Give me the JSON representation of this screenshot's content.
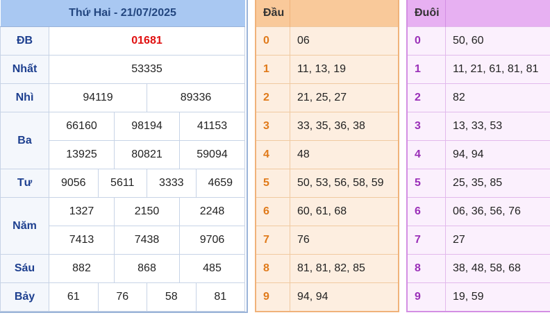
{
  "results": {
    "title": "Thứ Hai - 21/07/2025",
    "prizes": [
      {
        "label": "ĐB",
        "values": [
          "01681"
        ]
      },
      {
        "label": "Nhất",
        "values": [
          "53335"
        ]
      },
      {
        "label": "Nhì",
        "values": [
          "94119",
          "89336"
        ]
      },
      {
        "label": "Ba",
        "values": [
          "66160",
          "98194",
          "41153",
          "13925",
          "80821",
          "59094"
        ]
      },
      {
        "label": "Tư",
        "values": [
          "9056",
          "5611",
          "3333",
          "4659"
        ]
      },
      {
        "label": "Năm",
        "values": [
          "1327",
          "2150",
          "2248",
          "7413",
          "7438",
          "9706"
        ]
      },
      {
        "label": "Sáu",
        "values": [
          "882",
          "868",
          "485"
        ]
      },
      {
        "label": "Bảy",
        "values": [
          "61",
          "76",
          "58",
          "81"
        ]
      }
    ]
  },
  "dau": {
    "header": "Đầu",
    "rows": [
      {
        "k": "0",
        "v": "06"
      },
      {
        "k": "1",
        "v": "11, 13, 19"
      },
      {
        "k": "2",
        "v": "21, 25, 27"
      },
      {
        "k": "3",
        "v": "33, 35, 36, 38"
      },
      {
        "k": "4",
        "v": "48"
      },
      {
        "k": "5",
        "v": "50, 53, 56, 58, 59"
      },
      {
        "k": "6",
        "v": "60, 61, 68"
      },
      {
        "k": "7",
        "v": "76"
      },
      {
        "k": "8",
        "v": "81, 81, 82, 85"
      },
      {
        "k": "9",
        "v": "94, 94"
      }
    ]
  },
  "duoi": {
    "header": "Đuôi",
    "rows": [
      {
        "k": "0",
        "v": "50, 60"
      },
      {
        "k": "1",
        "v": "11, 21, 61, 81, 81"
      },
      {
        "k": "2",
        "v": "82"
      },
      {
        "k": "3",
        "v": "13, 33, 53"
      },
      {
        "k": "4",
        "v": "94, 94"
      },
      {
        "k": "5",
        "v": "25, 35, 85"
      },
      {
        "k": "6",
        "v": "06, 36, 56, 76"
      },
      {
        "k": "7",
        "v": "27"
      },
      {
        "k": "8",
        "v": "38, 48, 58, 68"
      },
      {
        "k": "9",
        "v": "19, 59"
      }
    ]
  }
}
